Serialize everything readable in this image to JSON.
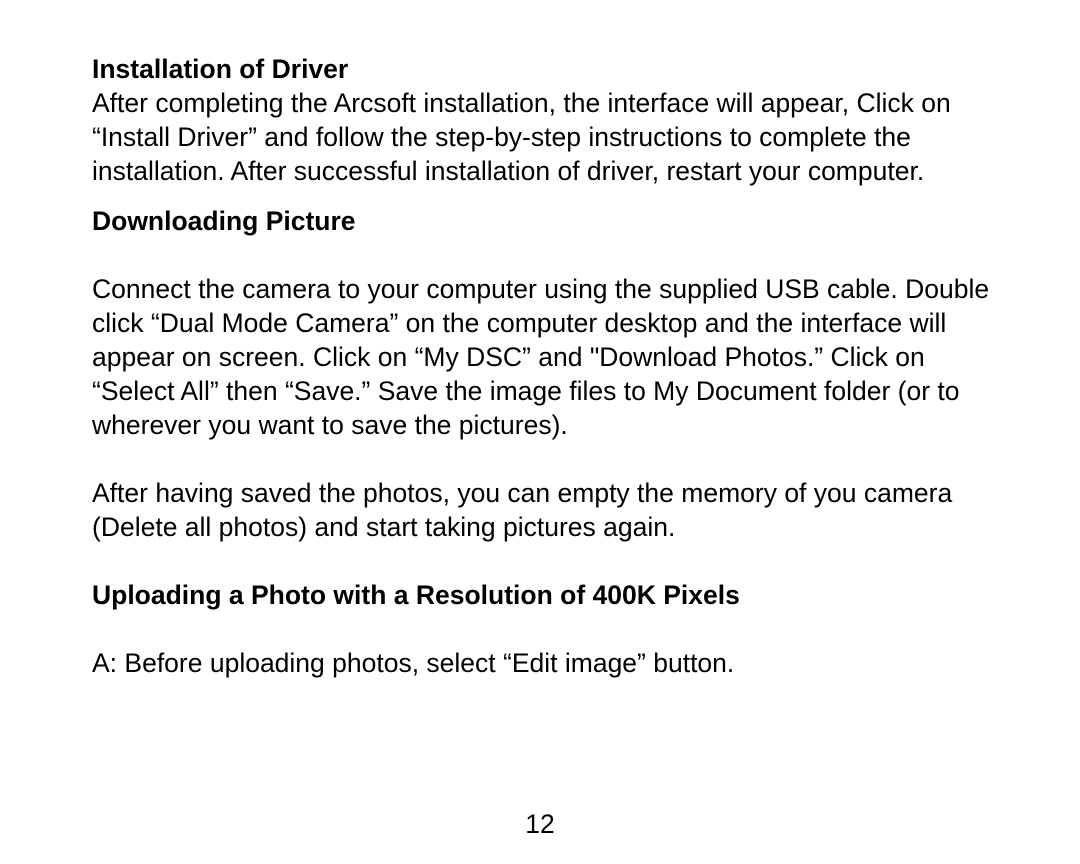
{
  "section1": {
    "heading": "Installation of Driver",
    "body": "After completing the Arcsoft installation, the interface will appear, Click on “Install Driver” and follow the step-by-step instructions to complete the installation.  After successful installation of driver, restart your computer."
  },
  "section2": {
    "heading": "Downloading Picture",
    "body1": "Connect the camera to your computer using the supplied USB cable. Double click “Dual Mode Camera” on the computer desktop and the interface will appear on screen.  Click on “My DSC”  and \"Download Photos.”  Click on “Select All” then “Save.”  Save the image files to My Document folder (or to wherever you want to save the pictures).",
    "body2": "After having saved the photos, you can empty the memory of you camera (Delete all photos) and start taking pictures again."
  },
  "section3": {
    "heading": "Uploading a Photo with a Resolution of 400K Pixels",
    "body": "A:  Before uploading photos,  select “Edit image” button."
  },
  "page_number": "12"
}
